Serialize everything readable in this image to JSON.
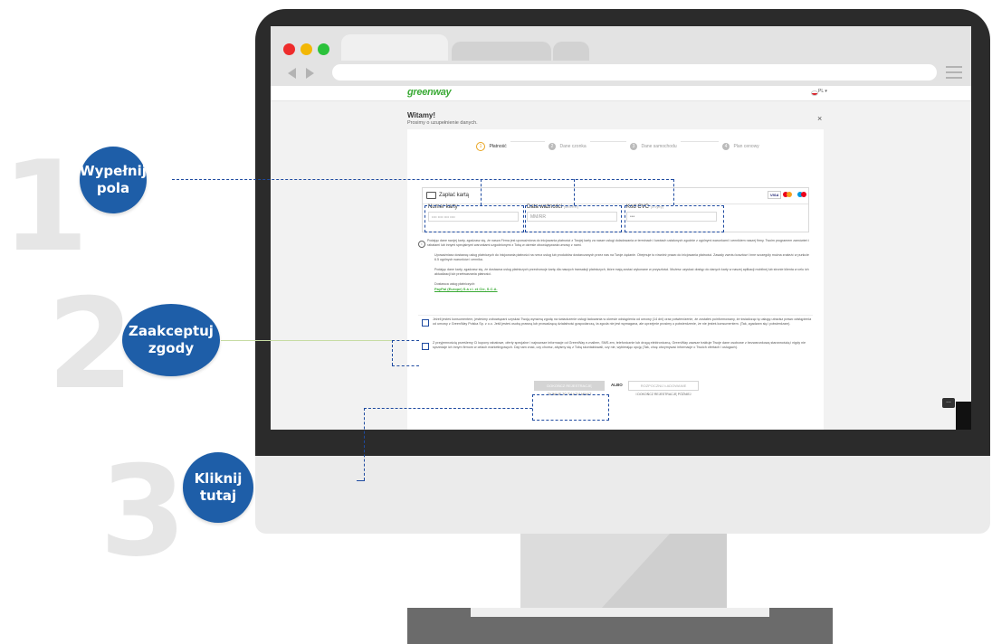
{
  "steps": [
    {
      "number": "1",
      "label_line1": "Wypełnij",
      "label_line2": "pola"
    },
    {
      "number": "2",
      "label_line1": "Zaakceptuj",
      "label_line2": "zgody"
    },
    {
      "number": "3",
      "label_line1": "Kliknij",
      "label_line2": "tutaj"
    }
  ],
  "site": {
    "logo": "greenway",
    "language": "PL",
    "title": "Witamy!",
    "subtitle": "Prosimy o uzupełnienie danych.",
    "close": "×"
  },
  "progress": [
    {
      "num": "1",
      "label": "Płatność"
    },
    {
      "num": "2",
      "label": "Dane czonka"
    },
    {
      "num": "3",
      "label": "Dane samochodu"
    },
    {
      "num": "4",
      "label": "Plan cenowy"
    }
  ],
  "payment": {
    "method_label": "Zapłać kartą",
    "brands": [
      "VISA",
      "mastercard",
      "maestro"
    ],
    "card_number_label": "Numer karty",
    "card_number_placeholder": "•••• •••• •••• ••••",
    "expiry_label": "Data ważności",
    "expiry_hint": "(MM/RR)",
    "expiry_placeholder": "MM/RR",
    "cvc_label": "Kod CVC",
    "cvc_hint": "(3 cyfry)",
    "cvc_placeholder": "•••"
  },
  "info": {
    "p1": "Podając dane swojej karty, zgadzasz się, że nasza Firma jest upoważniona do inicjowania płatności z Twojej karty za nasze usługi doładowania w terminach i kwotach ustalonych zgodnie z ogólnymi warunkami i cennikiem naszej firmy. Twoim programem zamówień i rabatami lub innymi specjalnymi warunkami uzgodnionymi z Tobą w okresie obowiązywania umowy z nami.",
    "p2": "Upoważniasz dostawcę usług płatniczych do inicjowania płatności na rzecz usług lub produktów dostarczanych przez nas na Twoje żądanie. Obejmuje to również prawo do inicjowania płatności. Zasady zwrotu kosztów i inne szczegóły można znaleźć w punkcie 6.5 ogólnych warunków i cennika.",
    "p3": "Podając dane karty, zgadzasz się, że dostawca usług płatniczych przechowuje kartę dla naszych transakcji płatniczych, które mają zostać wykonane w przyszłości. Możesz uzyskać dostęp do danych karty w naszej aplikacji mobilnej lub stronie klienta w celu ich aktualizacji lub przetwarzania płatności.",
    "provider_label": "Dostawca usług płatniczych:",
    "provider_link": "PayPal (Europe) S.à r.l. et Cie, S.C.A."
  },
  "consents": {
    "consent1": "Jeżeli jesteś konsumentem, jesteśmy zobowiązani uzyskać Twoją wyraźną zgodę na świadczenie usługi ładowania w okresie odstąpienia od umowy (14 dni) oraz potwierdzenie, że zostałeś poinformowany, że świadcząc tę usługę utracisz prawo odstąpienia od umowy z GreenWay Polska Sp. z o.o. Jeśli jesteś osobą prawną lub prowadzącą działalność gospodarczą, ta zgoda nie jest wymagana, ale uprzejmie prosimy o potwierdzenie, że nie jesteś konsumentem. (Tak, zgadzam się i potwierdzam).",
    "consent2": "Z przyjemnością prześlemy Ci kupony rabatowe, oferty specjalne i najnowsze informacje od GreenWay e-mailem, SMS-em, telefonicznie lub drogą elektroniczną. GreenWay zawsze traktuje Twoje dane osobowe z bezwarunkową starannością i nigdy nie sprzedaje ich innym firmom w celach marketingowych. Daj nam znać, czy chcesz, abyśmy się z Tobą skontaktowali, czy nie, wybierając opcję (Tak, chcę otrzymywać informacje o Twoich ofertach i usługach)."
  },
  "actions": {
    "finish_button": "DOKOŃCZ REJESTRACJĘ",
    "finish_hint": "ZAJMUJE TO TYLKO 5 MINUT",
    "or": "ALBO",
    "charge_button": "ROZPOCZNIJ ŁADOWANIE",
    "charge_hint": "I DOKOŃCZ REJESTRACJĘ PÓŹNIEJ"
  },
  "colors": {
    "accent": "#1e5ea8",
    "brand_green": "#3aaa35",
    "bignum": "#e6e6e6"
  }
}
